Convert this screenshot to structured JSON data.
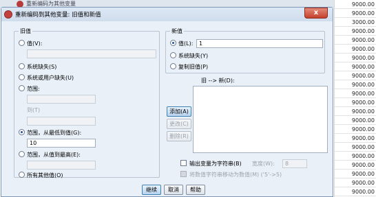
{
  "background": {
    "window_title": "重新编码为其他变量",
    "cells": [
      "9000.00",
      "9000.00",
      "3000.00",
      "9000.00",
      "9000.00",
      "9000.00",
      "9000.00",
      "9000.00",
      "9000.00",
      "9000.00",
      "9000.00",
      "9000.00",
      "9000.00",
      "9000.00",
      "9000.00",
      "9000.00",
      "9000.00",
      "9000.00",
      "9000.00",
      "9000.00",
      "9000.00",
      "9000.00"
    ]
  },
  "dialog": {
    "title": "重新编码到其他变量: 旧值和新值",
    "close_label": "x",
    "old_value": {
      "legend": "旧值",
      "value_label": "值(V):",
      "system_missing_label": "系统缺失(S)",
      "system_or_user_missing_label": "系统或用户缺失(U)",
      "range_label": "范围:",
      "through_label": "到(T)",
      "range_lowest_label": "范围，从最低到值(G):",
      "range_lowest_value": "10",
      "range_highest_label": "范围，从值到最高(E):",
      "all_other_label": "所有其他值(O)",
      "selected": "range_lowest"
    },
    "new_value": {
      "legend": "新值",
      "value_label": "值(L):",
      "value": "1",
      "system_missing_label": "系统缺失(Y)",
      "copy_old_label": "复制旧值(P)",
      "selected": "value"
    },
    "mapping": {
      "label": "旧 --> 新(D):",
      "add_label": "添加(A)",
      "change_label": "更改(C)",
      "remove_label": "删除(R)"
    },
    "output_string_label": "输出变量为字符串(B)",
    "width_label": "宽度(W):",
    "width_value": "8",
    "convert_numeric_label": "将数值字符串移动为数值(M) ('5'->5)",
    "footer": {
      "continue_label": "继续",
      "cancel_label": "取消",
      "help_label": "帮助"
    }
  }
}
